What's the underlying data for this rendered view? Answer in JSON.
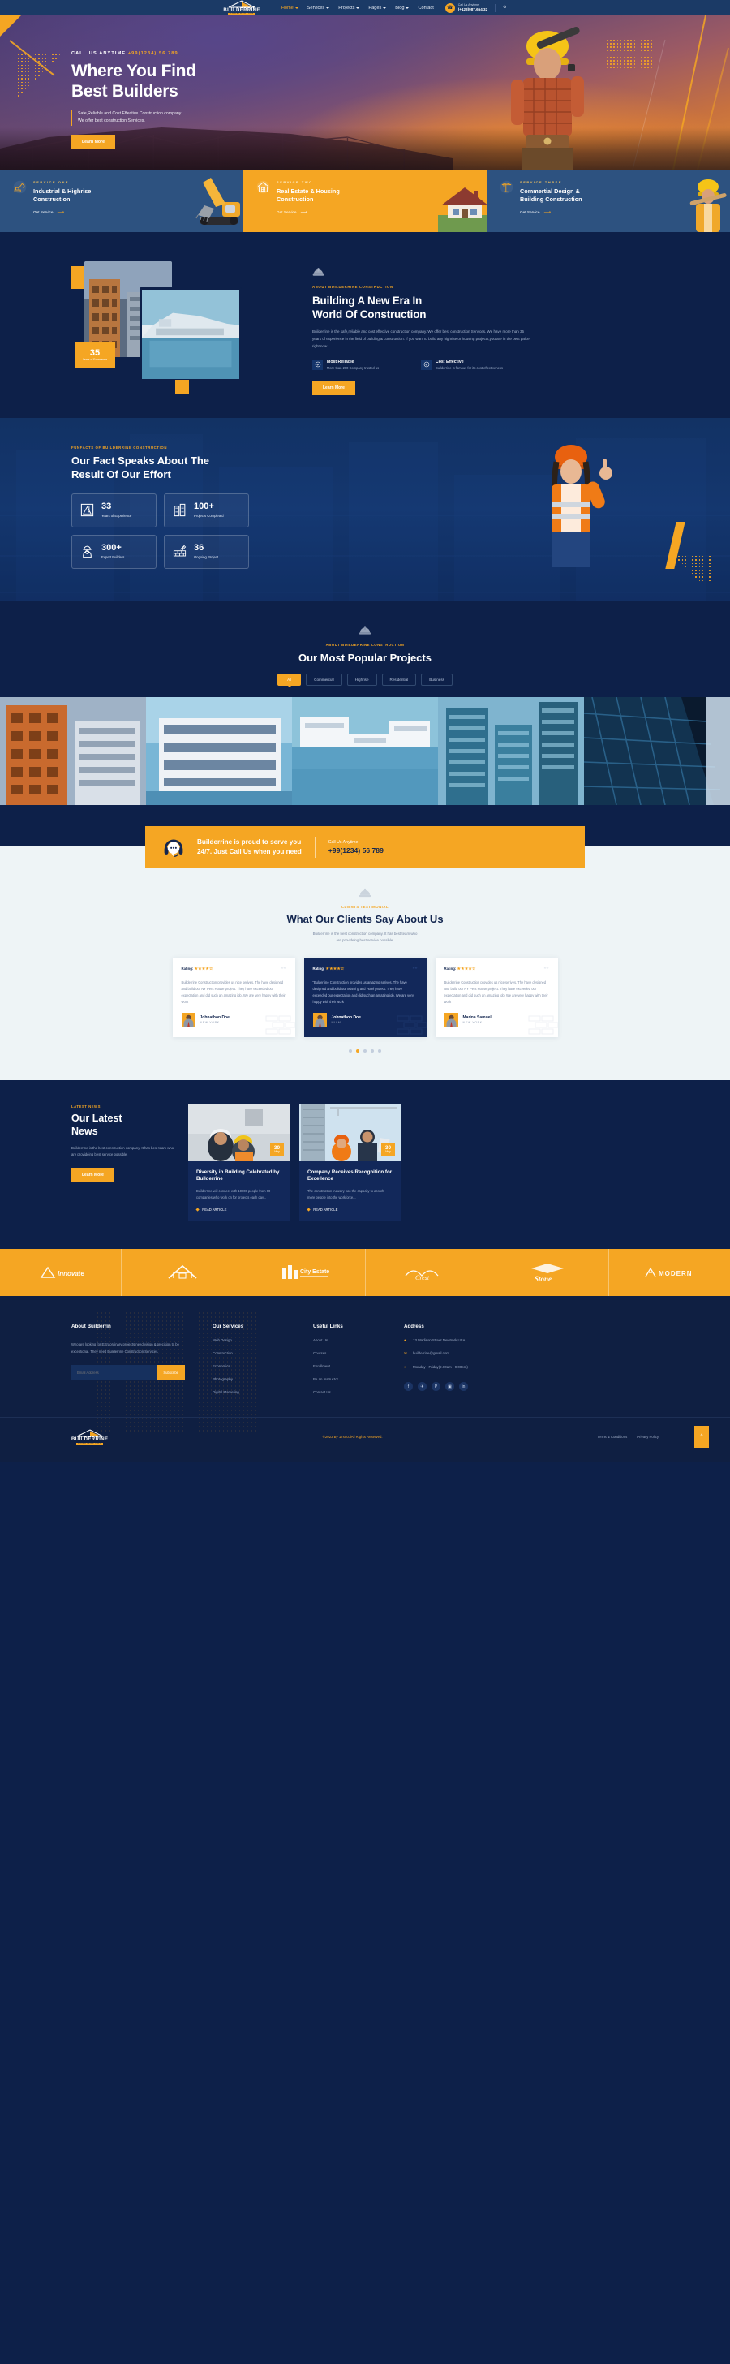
{
  "brand": {
    "name": "BUILDERRINE",
    "tagline": "CONSTRUCTION",
    "accent": "#f5a623",
    "navy": "#0d2049"
  },
  "header": {
    "nav": [
      {
        "label": "Home",
        "caret": true,
        "active": true
      },
      {
        "label": "Services",
        "caret": true,
        "active": false
      },
      {
        "label": "Projects",
        "caret": true,
        "active": false
      },
      {
        "label": "Pages",
        "caret": true,
        "active": false
      },
      {
        "label": "Blog",
        "caret": true,
        "active": false
      },
      {
        "label": "Contact",
        "caret": false,
        "active": false
      }
    ],
    "call_label": "Call Us Anytime",
    "call_number": "(+123)987.654.32",
    "phone_icon": "phone-icon",
    "search_icon": "search-icon"
  },
  "hero": {
    "eyebrow_label": "CALL US ANYTIME",
    "eyebrow_phone": "+99(1234) 56 789",
    "title_line1": "Where You Find",
    "title_line2": "Best Builders",
    "desc_line1": "Safe,Reliable and Cost Effective Construction company.",
    "desc_line2": "We offer best construction Services.",
    "button": "Learn More"
  },
  "services": [
    {
      "label": "SERVICE ONE",
      "title_line1": "Industrial & Highrise",
      "title_line2": "Construction",
      "link": "Get Service",
      "icon": "excavator-icon",
      "theme": "blue"
    },
    {
      "label": "SERVICE TWO",
      "title_line1": "Real Estate & Housing",
      "title_line2": "Construction",
      "link": "Get Service",
      "icon": "house-icon",
      "theme": "orange"
    },
    {
      "label": "SERVICE THREE",
      "title_line1": "Commertial Design &",
      "title_line2": "Building Construction",
      "link": "Get Service",
      "icon": "crane-icon",
      "theme": "blue"
    }
  ],
  "about": {
    "badge_number": "35",
    "badge_text": "Years of Experience",
    "eyebrow": "ABOUT BUILDERRINE CONSTRUCTION",
    "title_line1": "Building A New Era In",
    "title_line2": "World Of Construction",
    "paragraph": "Builderrine is the safe,reliable and cost effective construction company. We offer best construction Services. We have more than 35 years of experience in the field of building & construction. If you want to build any highrise or housing projects,you are in the best palce right now",
    "features": [
      {
        "title": "Most Reliable",
        "desc": "More than 200 Company trusted us",
        "icon": "check-circle-icon"
      },
      {
        "title": "Cost Effective",
        "desc": "Builderrine is famous for its cost effectiveness",
        "icon": "check-circle-icon"
      }
    ],
    "button": "Learn More"
  },
  "facts": {
    "eyebrow": "FUNFACTS OF BUILDERRINE CONSTRUCTION",
    "title_line1": "Our Fact Speaks About The",
    "title_line2": "Result Of Our Effort",
    "stats": [
      {
        "number": "33",
        "label": "Years of Experience",
        "icon": "blueprint-icon"
      },
      {
        "number": "100+",
        "label": "Projects Completed",
        "icon": "buildings-icon"
      },
      {
        "number": "300+",
        "label": "Expert Builders",
        "icon": "worker-icon"
      },
      {
        "number": "36",
        "label": "Ongoing Project",
        "icon": "brick-trowel-icon"
      }
    ]
  },
  "projects": {
    "eyebrow": "ABOUT BUILDERRINE CONSTRUCTION",
    "title": "Our Most Popular Projects",
    "tabs": [
      {
        "label": "All",
        "active": true
      },
      {
        "label": "Commercial",
        "active": false
      },
      {
        "label": "Highrise",
        "active": false
      },
      {
        "label": "Residential",
        "active": false
      },
      {
        "label": "Business",
        "active": false
      }
    ]
  },
  "cta": {
    "icon": "headset-icon",
    "text_line1": "Builderrine is proud to serve you",
    "text_line2": "24/7. Just Call Us when you need",
    "call_label": "Call Us Anytime",
    "call_number": "+99(1234) 56 789"
  },
  "testimonials": {
    "eyebrow": "CLIENTS TESTIMONIAL",
    "title": "What Our Clients Say About Us",
    "sub_line1": "Builderrine is the best construction company. It has best team who",
    "sub_line2": "are provideing best service possible.",
    "rating_label": "Rating:",
    "stars_filled": 4,
    "stars_total": 5,
    "cards": [
      {
        "rating_label": "Rating:",
        "body": "Builderrine Construction provides us nice serives. The have designed and build our NY Pent House project. They have exceeded our expectation and did such an amazing job. We are very happy with their work\"",
        "name": "Johnathon Doe",
        "city": "NEW YORK",
        "dark": false
      },
      {
        "rating_label": "Rating:",
        "body": "\"Bulderrine Construction provides us amazing serives. The have designed and build our Miami grand Hotel project. They have exceeded our expectation and did such an amazing job. We are very happy with their work\"",
        "name": "Johnathon Doe",
        "city": "MIAMI",
        "dark": true
      },
      {
        "rating_label": "Rating:",
        "body": "Builderrine Construction provides us nice serives. The have designed and build our NY Pent House project. They have exceeded our expectation and did such an amazing job. We are very happy with their work\"",
        "name": "Marina Samuel",
        "city": "NEW YORK",
        "dark": false
      }
    ],
    "pager_dots": 5,
    "pager_active": 1
  },
  "news": {
    "eyebrow": "LATEST NEWS",
    "title_line1": "Our Latest",
    "title_line2": "News",
    "paragraph": "Builderrine is the best construction company. It has best team who are provideing best service possible.",
    "button": "Learn More",
    "articles": [
      {
        "day": "30",
        "month": "May",
        "title": "Diversity in Building Celebrated by Builderrine",
        "desc": "Builderrine will connect with 10000 people from 90 companies who work on for projects each day...",
        "read": "READ ARTICLE"
      },
      {
        "day": "30",
        "month": "May",
        "title": "Company Receives Recognition for Excellence",
        "desc": "The construction industry has the capacity to absorb more people into the workforce...",
        "read": "READ ARTICLE"
      }
    ]
  },
  "brands": [
    {
      "name": "Innovate",
      "icon": "innovate-logo"
    },
    {
      "name": "Archi House",
      "icon": "archi-house-logo"
    },
    {
      "name": "City Estate",
      "icon": "city-estate-logo"
    },
    {
      "name": "Crest",
      "icon": "crest-logo"
    },
    {
      "name": "Stone",
      "icon": "stone-logo"
    },
    {
      "name": "MODERN",
      "icon": "modern-logo"
    }
  ],
  "footer": {
    "about_heading": "About Builderrin",
    "about_text": "Who are looking for Extraordinary projects need vision & precision to be exceptional. They need Builderrine Construction Services.",
    "email_placeholder": "Email Address",
    "subscribe_label": "Subscribe",
    "services_heading": "Our Services",
    "services": [
      "Web Design",
      "Construction",
      "Economics",
      "Photography",
      "Digital Marketing"
    ],
    "links_heading": "Useful Links",
    "links": [
      "About Us",
      "Courses",
      "Enrollment",
      "Be an Instructor",
      "Contact Us"
    ],
    "address_heading": "Address",
    "address_items": [
      {
        "icon": "map-pin-icon",
        "text": "13 Madison Street NewYork,USA"
      },
      {
        "icon": "mail-icon",
        "text": "builderrine@gmail.com"
      },
      {
        "icon": "clock-icon",
        "text": "Monday - Friday(9.00am - 9.00pm)"
      }
    ],
    "social": [
      {
        "icon": "facebook-icon",
        "glyph": "f"
      },
      {
        "icon": "twitter-icon",
        "glyph": "✈"
      },
      {
        "icon": "pinterest-icon",
        "glyph": "P"
      },
      {
        "icon": "instagram-icon",
        "glyph": "▣"
      },
      {
        "icon": "linkedin-icon",
        "glyph": "in"
      }
    ],
    "copyright_pre": "©2023 By ",
    "copyright_brand": "17sucoi",
    "copyright_post": "All Rights Reserved.",
    "bottom_links": [
      "Terms & Conditions",
      "Privacy Policy"
    ],
    "to_top_icon": "chevron-up-icon"
  }
}
